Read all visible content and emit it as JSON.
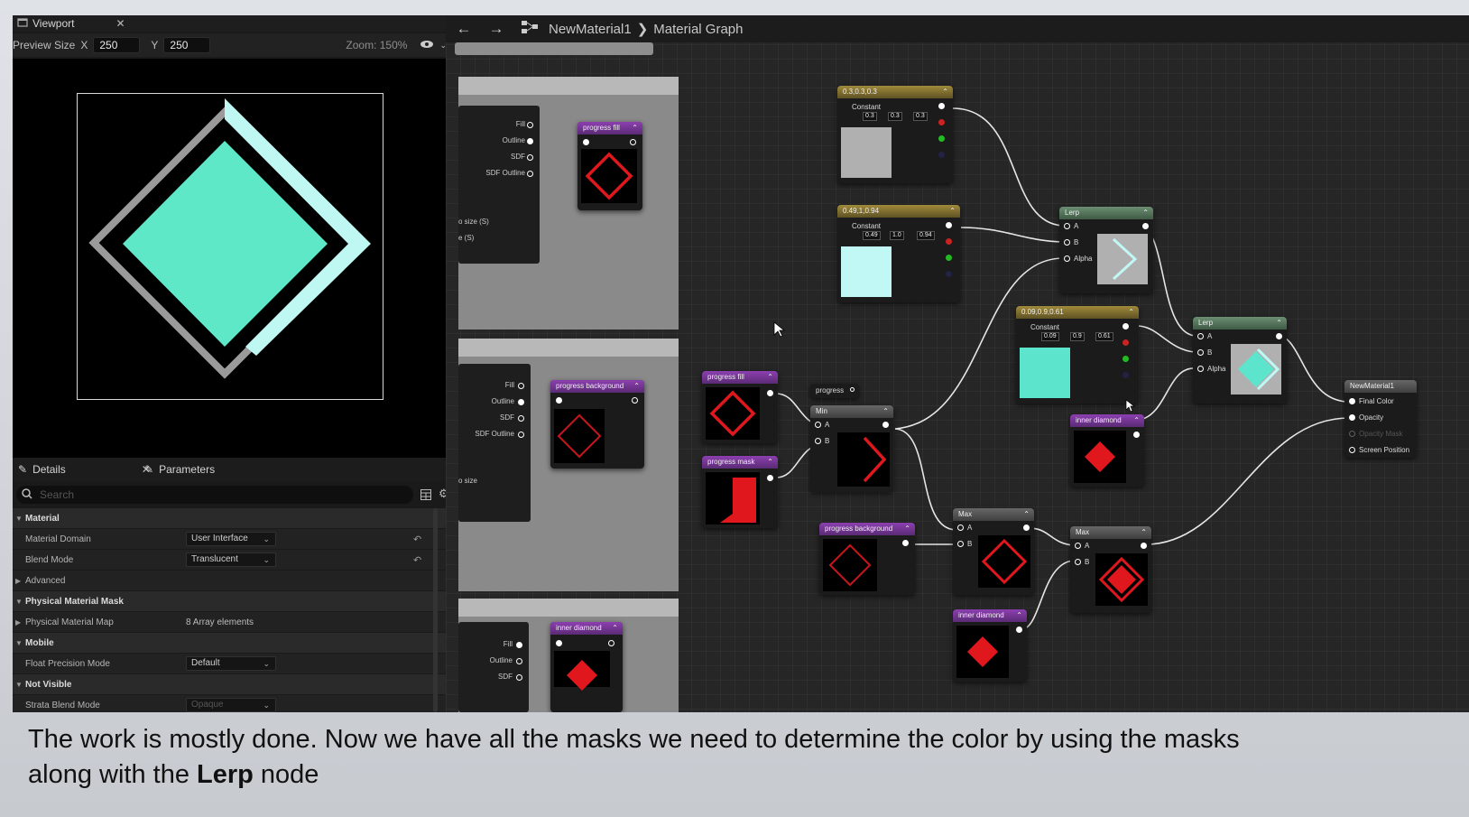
{
  "viewport_tab": {
    "label": "Viewport"
  },
  "preview": {
    "label": "Preview Size",
    "x_label": "X",
    "x_value": "250",
    "y_label": "Y",
    "y_value": "250",
    "zoom": "Zoom: 150%"
  },
  "breadcrumb": {
    "material": "NewMaterial1",
    "graph": "Material Graph"
  },
  "details": {
    "tab_details": "Details",
    "tab_parameters": "Parameters",
    "search_placeholder": "Search",
    "rows": [
      {
        "type": "section",
        "label": "Material"
      },
      {
        "type": "item",
        "label": "Material Domain",
        "value": "User Interface",
        "dropdown": true,
        "reset": true
      },
      {
        "type": "item",
        "label": "Blend Mode",
        "value": "Translucent",
        "dropdown": true,
        "reset": true
      },
      {
        "type": "item",
        "label": "Advanced"
      },
      {
        "type": "section",
        "label": "Physical Material Mask"
      },
      {
        "type": "item",
        "label": "Physical Material Map",
        "value": "8 Array elements"
      },
      {
        "type": "section",
        "label": "Mobile"
      },
      {
        "type": "item",
        "label": "Float Precision Mode",
        "value": "Default",
        "dropdown": true
      },
      {
        "type": "section",
        "label": "Not Visible"
      },
      {
        "type": "item",
        "label": "Strata Blend Mode",
        "value": "Opaque",
        "dropdown": true,
        "disabled": true
      }
    ]
  },
  "graph": {
    "left_pins": {
      "a": [
        "Fill",
        "Outline",
        "SDF",
        "SDF Outline"
      ],
      "b": [
        "Fill",
        "Outline",
        "SDF",
        "SDF Outline"
      ],
      "c": [
        "Fill",
        "Outline",
        "SDF"
      ],
      "size_a": "o size (S)",
      "size_b": "e (S)",
      "size_c": "o size"
    },
    "nodes": {
      "progress_fill_top": "progress fill",
      "progress_background_mid": "progress background",
      "inner_diamond_bottom": "inner diamond",
      "const1_title": "0.3,0.3,0.3",
      "const1_label": "Constant",
      "const1_values": [
        "0.3",
        "0.3",
        "0.3"
      ],
      "const2_title": "0.49,1,0.94",
      "const2_label": "Constant",
      "const2_values": [
        "0.49",
        "1.0",
        "0.94"
      ],
      "const3_title": "0.09,0.9,0.61",
      "const3_label": "Constant",
      "const3_values": [
        "0.09",
        "0.9",
        "0.61"
      ],
      "lerp1": "Lerp",
      "lerp2": "Lerp",
      "lerp_pins": [
        "A",
        "B",
        "Alpha"
      ],
      "progress_fill": "progress fill",
      "progress_mask": "progress mask",
      "progress": "progress",
      "min": "Min",
      "max1": "Max",
      "max2": "Max",
      "minmax_pins": [
        "A",
        "B"
      ],
      "progress_background": "progress background",
      "inner_diamond_a": "inner diamond",
      "inner_diamond_b": "inner diamond",
      "result": "NewMaterial1",
      "result_pins": [
        "Final Color",
        "Opacity",
        "Opacity Mask",
        "Screen Position"
      ]
    }
  },
  "colors": {
    "diamond_fill": "#5ee8c8",
    "diamond_outline": "#9a9a9a",
    "diamond_accent": "#bff7f2",
    "mask_red": "#e0181e",
    "const_gray": "#b0b0b0",
    "const_cyan": "#c1f8f5",
    "const_green": "#5ce5cc"
  },
  "caption": {
    "line1": "The work is mostly done. Now we have all the masks we need to determine the color by using the masks",
    "line2_pre": "along with the ",
    "line2_bold": "Lerp",
    "line2_post": " node"
  }
}
